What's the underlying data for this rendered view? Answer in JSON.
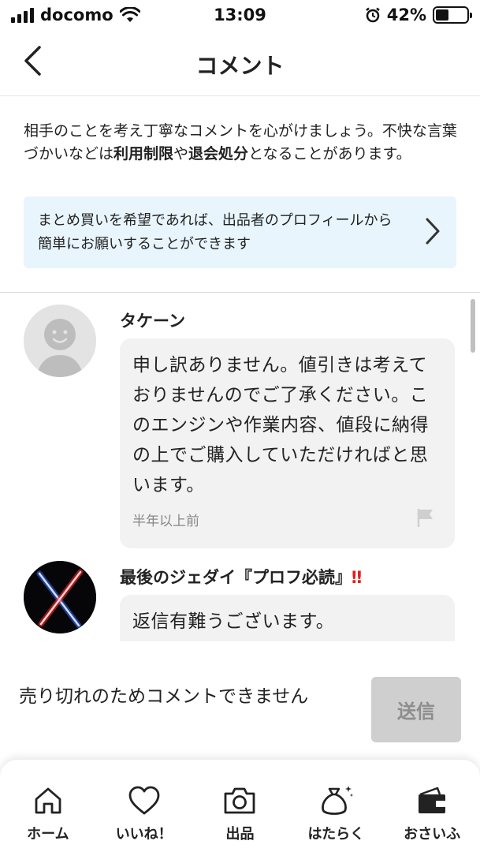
{
  "status_bar": {
    "carrier": "docomo",
    "time": "13:09",
    "battery_percent": "42%",
    "battery_level": 0.42
  },
  "header": {
    "title": "コメント"
  },
  "notice": {
    "text_1": "相手のことを考え丁寧なコメントを心がけましょう。不快な言葉づかいなどは",
    "bold_1": "利用制限",
    "text_2": "や",
    "bold_2": "退会処分",
    "text_3": "となることがあります。"
  },
  "bundle_banner": {
    "text": "まとめ買いを希望であれば、出品者のプロフィールから簡単にお願いすることができます"
  },
  "comments": [
    {
      "username": "タケーン",
      "text": "申し訳ありません。値引きは考えておりませんのでご了承ください。このエンジンや作業内容、値段に納得の上でご購入していただければと思います。",
      "timestamp": "半年以上前"
    },
    {
      "username": "最後のジェダイ『プロフ必読』",
      "username_suffix": "‼",
      "text": "返信有難うございます。"
    }
  ],
  "compose": {
    "sold_out_text": "売り切れのためコメントできません",
    "send_label": "送信"
  },
  "tab_bar": {
    "items": [
      {
        "label": "ホーム",
        "icon": "home-icon"
      },
      {
        "label": "いいね！",
        "icon": "heart-icon"
      },
      {
        "label": "出品",
        "icon": "camera-icon"
      },
      {
        "label": "はたらく",
        "icon": "money-bag-icon"
      },
      {
        "label": "おさいふ",
        "icon": "wallet-icon"
      }
    ]
  },
  "colors": {
    "banner_bg": "#e8f5fc",
    "bubble_bg": "#f2f2f2",
    "send_disabled_bg": "#cfcfcf",
    "alert_red": "#e02020"
  }
}
